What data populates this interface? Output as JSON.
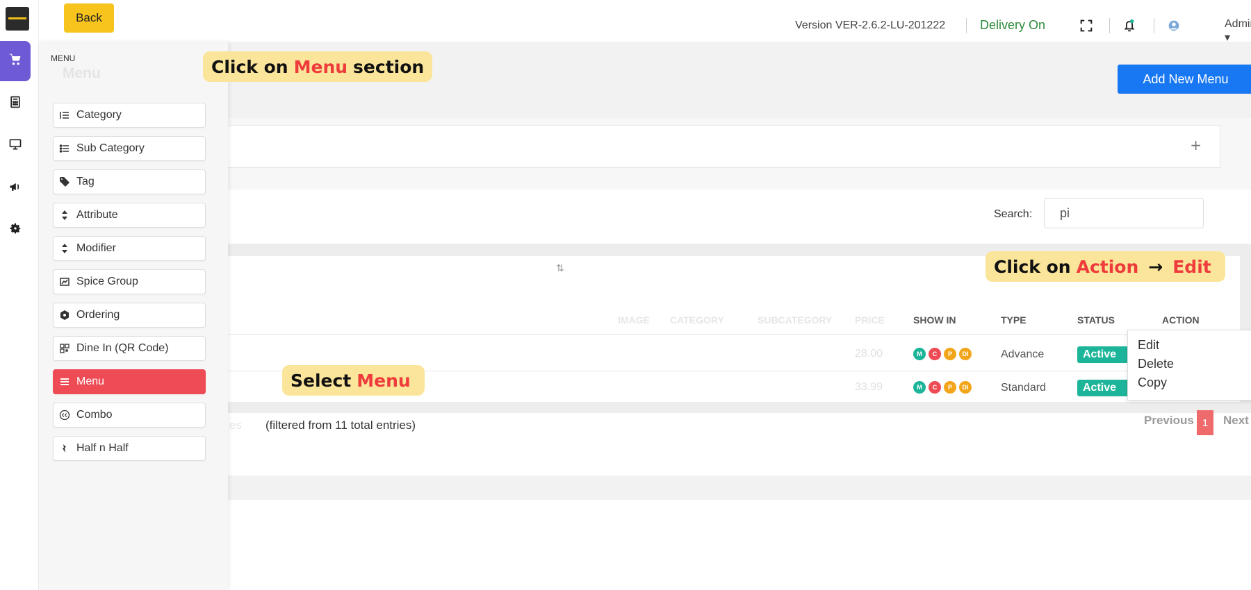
{
  "topbar": {
    "back_label": "Back",
    "version": "Version VER-2.6.2-LU-201222",
    "delivery": "Delivery On",
    "admin": "Admin"
  },
  "rail": {
    "icons": [
      "cart-icon",
      "calculator-icon",
      "monitor-icon",
      "megaphone-icon",
      "gear-icon"
    ]
  },
  "panel": {
    "heading": "MENU",
    "ghost_title": "Menu",
    "items": [
      {
        "label": "Category",
        "icon": "category-list-icon"
      },
      {
        "label": "Sub Category",
        "icon": "subcategory-list-icon"
      },
      {
        "label": "Tag",
        "icon": "tag-icon"
      },
      {
        "label": "Attribute",
        "icon": "sort-icon"
      },
      {
        "label": "Modifier",
        "icon": "sort-icon"
      },
      {
        "label": "Spice Group",
        "icon": "spice-icon"
      },
      {
        "label": "Ordering",
        "icon": "ordering-icon"
      },
      {
        "label": "Dine In (QR Code)",
        "icon": "qr-code-icon"
      },
      {
        "label": "Menu",
        "icon": "hamburger-icon"
      },
      {
        "label": "Combo",
        "icon": "combo-icon"
      },
      {
        "label": "Half n Half",
        "icon": "half-icon"
      }
    ]
  },
  "main": {
    "add_button": "Add New Menu",
    "search_label": "Search:",
    "search_value": "pi",
    "columns": [
      "IMAGE",
      "CATEGORY",
      "SUBCATEGORY",
      "PRICE",
      "SHOW IN",
      "TYPE",
      "STATUS",
      "ACTION"
    ],
    "rows": [
      {
        "price": "28.00",
        "show_in": [
          "M",
          "C",
          "P",
          "DI"
        ],
        "type": "Advance",
        "status": "Active"
      },
      {
        "price": "33.99",
        "show_in": [
          "M",
          "C",
          "P",
          "DI"
        ],
        "type": "Standard",
        "status": "Active"
      }
    ],
    "action_menu": [
      "Edit",
      "Delete",
      "Copy"
    ],
    "showing": "(filtered from 11 total entries)",
    "showing_prefix": "es",
    "pager": {
      "previous": "Previous",
      "page": "1",
      "next": "Next"
    }
  },
  "callouts": {
    "menu_section": {
      "pre": "Click on",
      "hl": "Menu",
      "post": "section"
    },
    "action_edit": {
      "pre": "Click on",
      "hl": "Action",
      "arrow": "→",
      "hl2": "Edit"
    },
    "select_menu": {
      "pre": "Select",
      "hl": "Menu"
    }
  },
  "colors": {
    "rail_active": "#6f5ad6",
    "back_button": "#f7c31d",
    "add_button": "#1877f2",
    "menu_active": "#ee4b55",
    "status_active": "#1db59a",
    "callout_bg": "#fbe59a",
    "callout_highlight": "#ee3b3b",
    "dot_m": "#1db59a",
    "dot_c": "#ee4b55",
    "dot_p": "#f2a51a",
    "dot_di": "#f2a51a"
  }
}
